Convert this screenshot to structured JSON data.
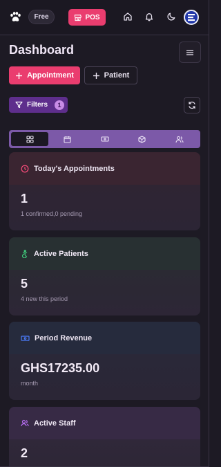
{
  "topbar": {
    "logo_icon": "paw-icon",
    "plan_badge": "Free",
    "pos_label": "POS",
    "icons": [
      "home-icon",
      "bell-icon",
      "moon-icon"
    ],
    "avatar_icon": "brand-avatar"
  },
  "header": {
    "title": "Dashboard",
    "menu_icon": "hamburger-icon",
    "add_appointment_label": "Appointment",
    "add_patient_label": "Patient",
    "filters_label": "Filters",
    "filters_count": "1",
    "refresh_icon": "refresh-icon"
  },
  "tabs": [
    {
      "icon": "grid-icon",
      "active": true
    },
    {
      "icon": "calendar-icon",
      "active": false
    },
    {
      "icon": "banknote-icon",
      "active": false
    },
    {
      "icon": "package-icon",
      "active": false
    },
    {
      "icon": "users-icon",
      "active": false
    }
  ],
  "cards": [
    {
      "title": "Today's Appointments",
      "value": "1",
      "sub": "1 confirmed,0 pending",
      "icon": "clock-icon",
      "color": "#ff4d7d"
    },
    {
      "title": "Active Patients",
      "value": "5",
      "sub": "4 new this period",
      "icon": "accessibility-icon",
      "color": "#3fc67a"
    },
    {
      "title": "Period Revenue",
      "value": "GHS17235.00",
      "sub": "month",
      "icon": "banknote-icon",
      "color": "#4c7dff"
    },
    {
      "title": "Active Staff",
      "value": "2",
      "sub": "",
      "icon": "users-icon",
      "color": "#b56cf0"
    }
  ],
  "colors": {
    "accent": "#ea3d6f",
    "purple": "#5e2e8c",
    "background": "#1d1a24"
  }
}
